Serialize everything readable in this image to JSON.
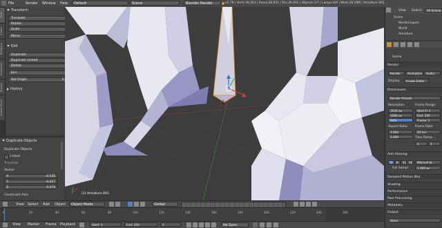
{
  "topbar": {
    "menus": [
      "File",
      "Render",
      "Window",
      "Help"
    ],
    "layout": "Default",
    "scene": "Scene",
    "engine": "Blender Render",
    "stats": "v2.79 | Verts:36,463 | Faces:26,931 | Tris:36,931 | Objects:1/7 | Lamps:0/0 | Mem:20.20M | Armature.001"
  },
  "tool_tabs": [
    "Tools",
    "Create",
    "Relations",
    "Animation",
    "Physics",
    "Grease Pencil"
  ],
  "tool_shelf": {
    "transform_header": "Transform",
    "transform_buttons": [
      "Translate",
      "Rotate",
      "Scale",
      "Mirror"
    ],
    "edit_header": "Edit",
    "edit_buttons": [
      "Duplicate",
      "Duplicate Linked",
      "Delete",
      "Join"
    ],
    "set_origin": "Set Origin",
    "history_header": "History"
  },
  "redo_panel": {
    "header": "Duplicate Objects",
    "title": "Duplicate Objects",
    "linked_label": "Linked",
    "translate_label": "Translate",
    "vector_label": "Vector",
    "x_label": "X:",
    "x_value": "-0.545",
    "y_label": "Y:",
    "y_value": "-0.027",
    "z_label": "Z:",
    "z_value": "0.078",
    "constraint_label": "Constraint Axis"
  },
  "viewport": {
    "view_label": "User Persp",
    "object_label": "(1) Armature.001"
  },
  "outliner": {
    "view_btn": "View",
    "search_btn": "Search",
    "all_scenes": "All Scenes",
    "items": [
      "Scene",
      "RenderLayers",
      "World",
      "Armature"
    ]
  },
  "properties": {
    "scene_crumb": "Scene",
    "render_header": "Render",
    "render_btn": "Render",
    "animation_btn": "Animation",
    "audio_btn": "Audio",
    "display_label": "Display:",
    "display_value": "Image Editor",
    "dimensions_header": "Dimensions",
    "presets": "Render Presets",
    "resolution_label": "Resolution:",
    "res_x": "1920 px",
    "res_y": "1080 px",
    "res_pct": "50%",
    "frame_range_label": "Frame Range:",
    "start_frame": "Start Fr 1",
    "end_frame": "End: 250",
    "frame_step": "Frame: 1",
    "aspect_label": "Aspect Ratio:",
    "aspect_x": "1.000",
    "aspect_y": "1.000",
    "frame_rate_label": "Frame Rate:",
    "fps": "24 fps",
    "time_remap": "Time Rema...",
    "remap_old": "1",
    "remap_new": "1",
    "aa_header": "Anti-Aliasing",
    "aa_samples": [
      "5",
      "8",
      "11",
      "16"
    ],
    "aa_filter": "Mitchell-N...",
    "full_sample": "Full Sampl",
    "filter_size": "1.000 px",
    "motion_blur": "Sampled Motion Blur",
    "collapsed": [
      "Shading",
      "Performance",
      "Post Processing",
      "Metadata",
      "Output"
    ],
    "output_path": "/tmp\\"
  },
  "view_header": {
    "items": [
      "View",
      "Select",
      "Add",
      "Object"
    ],
    "mode": "Object Mode",
    "orientation": "Global"
  },
  "timeline": {
    "ticks": [
      "0",
      "20",
      "40",
      "60",
      "80",
      "100",
      "120",
      "140",
      "160",
      "180",
      "200",
      "220",
      "240",
      "260"
    ],
    "menus": [
      "View",
      "Marker",
      "Frame",
      "Playback"
    ],
    "start_label": "Start:",
    "start_value": "1",
    "end_label": "End:",
    "end_value": "250",
    "current_frame": "1",
    "sync": "No Sync"
  },
  "colors": {
    "accent_blue": "#5680c2",
    "selection_orange": "#f08a24",
    "mesh_light": "#e8e8f2",
    "mesh_shadow": "#8a88b8"
  }
}
